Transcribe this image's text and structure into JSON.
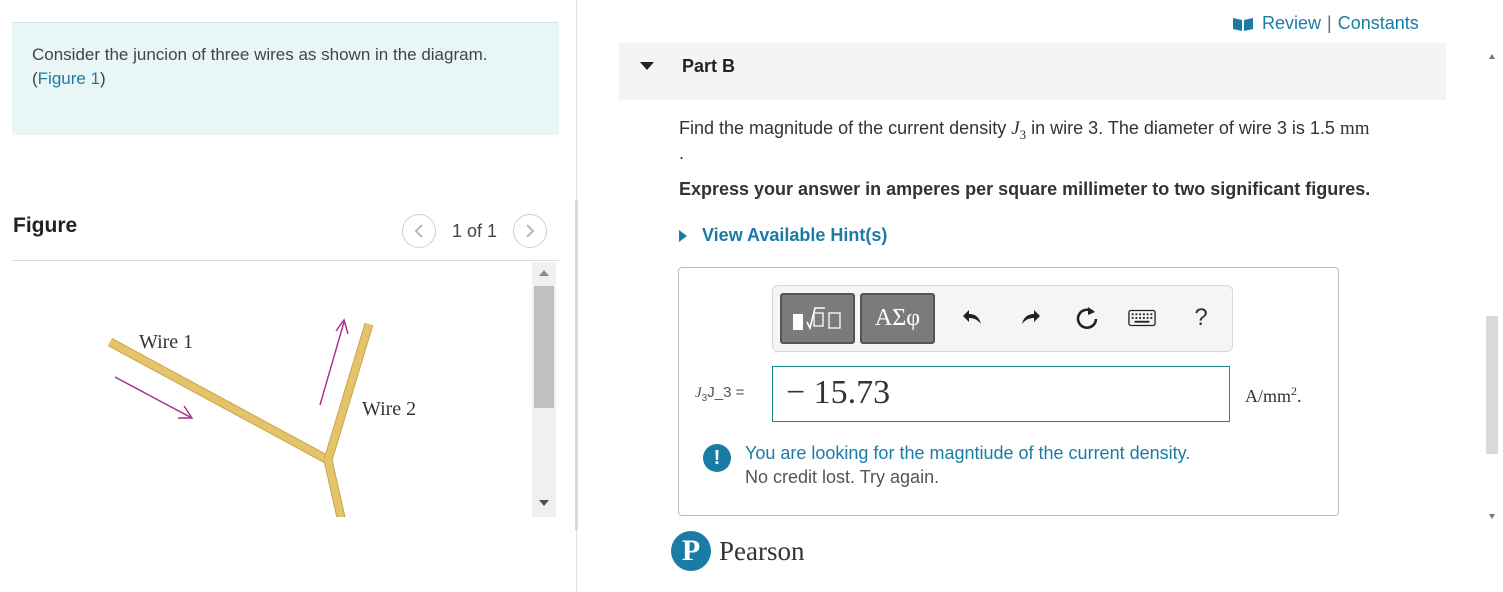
{
  "intro": {
    "text": "Consider the juncion of three wires as shown in the diagram. (",
    "figure_link": "Figure 1",
    "close": ")"
  },
  "figure_panel": {
    "title": "Figure",
    "prev_icon": "chevron-left-icon",
    "next_icon": "chevron-right-icon",
    "page": "1 of 1",
    "labels": {
      "wire1": "Wire 1",
      "wire2": "Wire 2"
    },
    "wire_color": "#e5c36a",
    "arrow_color": "#a52a8c"
  },
  "header_links": {
    "icon": "book-icon",
    "review": "Review",
    "separator": "|",
    "constants": "Constants"
  },
  "part": {
    "label": "Part B",
    "icon": "caret-down-icon"
  },
  "question": {
    "pre": "Find the magnitude of the current density ",
    "var": "J",
    "sub": "3",
    "mid": " in wire 3. The diameter of wire 3 is 1.5 ",
    "unit": "mm",
    "dot": "."
  },
  "instruction": "Express your answer in amperes per square millimeter to two significant figures.",
  "hints": {
    "label": "View Available Hint(s)",
    "icon": "caret-right-icon"
  },
  "toolbar": {
    "templates_icon": "math-templates-icon",
    "symbols": "ΑΣφ",
    "undo_icon": "undo-icon",
    "redo_icon": "redo-icon",
    "reset_icon": "reset-icon",
    "keyboard_icon": "keyboard-icon",
    "help": "?"
  },
  "answer": {
    "label_var": "J",
    "label_sub": "3",
    "label_text": "J_3 =",
    "value": "− 15.73",
    "unit_base": "A/mm",
    "unit_exp": "2",
    "unit_end": "."
  },
  "feedback": {
    "icon": "alert-icon",
    "icon_glyph": "!",
    "message": "You are looking for the magntiude of the current density.",
    "note": "No credit lost. Try again."
  },
  "footer": {
    "logo_letter": "P",
    "brand": "Pearson"
  },
  "colors": {
    "accent": "#1a7ca4",
    "intro_bg": "#e8f6f6",
    "part_bg": "#f4f4f4"
  }
}
